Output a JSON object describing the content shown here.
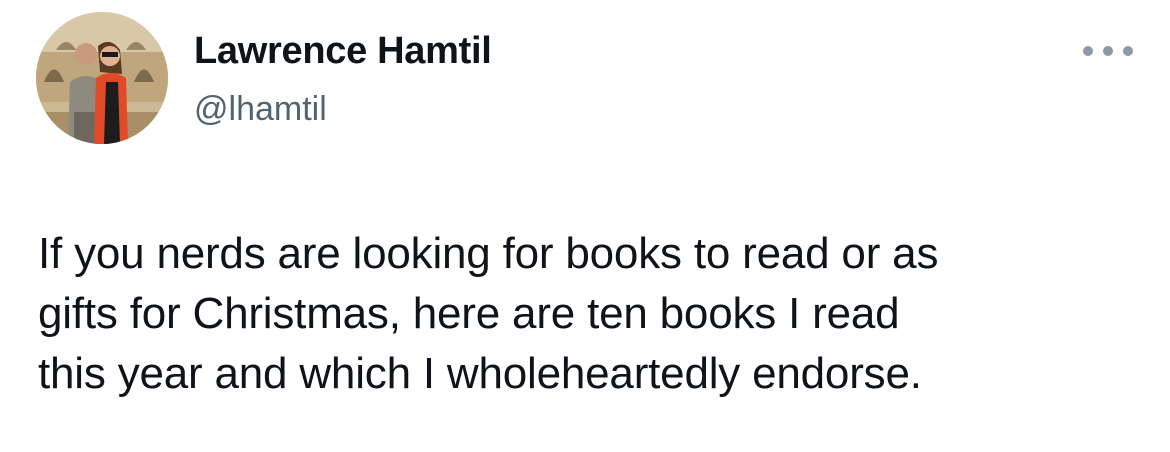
{
  "author": {
    "display_name": "Lawrence Hamtil",
    "handle": "@lhamtil",
    "avatar_icon": "profile-photo"
  },
  "menu": {
    "icon": "more-horizontal-icon"
  },
  "tweet": {
    "lines": [
      "If you nerds are looking for books to read or as",
      "gifts for Christmas, here are ten books I read",
      "this year and which I wholeheartedly endorse."
    ]
  },
  "colors": {
    "text_primary": "#0f1419",
    "text_secondary": "#536471",
    "background": "#ffffff"
  }
}
